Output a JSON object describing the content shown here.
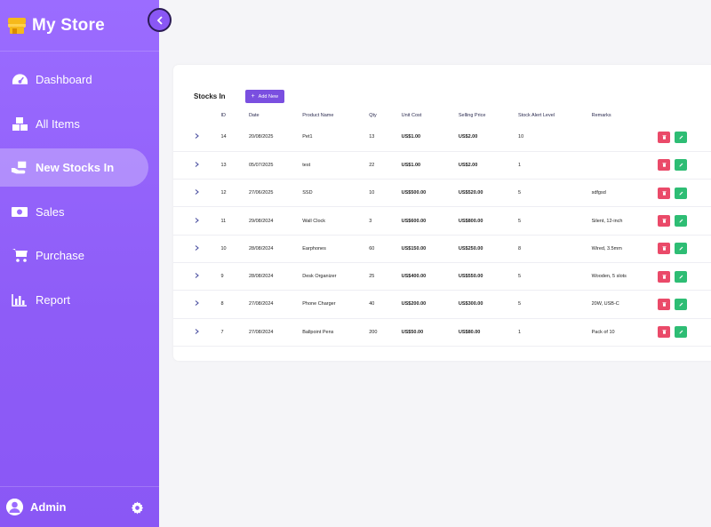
{
  "brand": {
    "title": "My Store"
  },
  "sidebar": {
    "items": [
      {
        "label": "Dashboard",
        "icon": "dashboard-gauge-icon",
        "active": false
      },
      {
        "label": "All Items",
        "icon": "boxes-icon",
        "active": false
      },
      {
        "label": "New Stocks In",
        "icon": "hand-box-icon",
        "active": true
      },
      {
        "label": "Sales",
        "icon": "money-bill-icon",
        "active": false
      },
      {
        "label": "Purchase",
        "icon": "cart-icon",
        "active": false
      },
      {
        "label": "Report",
        "icon": "bar-chart-icon",
        "active": false
      }
    ],
    "footer": {
      "name": "Admin"
    }
  },
  "page": {
    "title": "Stocks In",
    "add_label": "Add New"
  },
  "table": {
    "columns": [
      "ID",
      "Date",
      "Product Name",
      "Qty",
      "Unit Cost",
      "Selling Price",
      "Stock Alert Level",
      "Remarks"
    ],
    "rows": [
      [
        "14",
        "20/08/2025",
        "Pet1",
        "13",
        "US$1.00",
        "US$2.00",
        "10",
        ""
      ],
      [
        "13",
        "05/07/2025",
        "test",
        "22",
        "US$1.00",
        "US$2.00",
        "1",
        ""
      ],
      [
        "12",
        "27/06/2025",
        "SSD",
        "10",
        "US$500.00",
        "US$520.00",
        "5",
        "sdfgsd"
      ],
      [
        "11",
        "29/08/2024",
        "Wall Clock",
        "3",
        "US$600.00",
        "US$800.00",
        "5",
        "Silent, 12-inch"
      ],
      [
        "10",
        "28/08/2024",
        "Earphones",
        "60",
        "US$150.00",
        "US$250.00",
        "8",
        "Wired, 3.5mm"
      ],
      [
        "9",
        "28/08/2024",
        "Desk Organizer",
        "25",
        "US$400.00",
        "US$550.00",
        "5",
        "Wooden, 5 slots"
      ],
      [
        "8",
        "27/08/2024",
        "Phone Charger",
        "40",
        "US$200.00",
        "US$300.00",
        "5",
        "20W, USB-C"
      ],
      [
        "7",
        "27/08/2024",
        "Ballpoint Pens",
        "200",
        "US$50.00",
        "US$80.00",
        "1",
        "Pack of 10"
      ]
    ]
  },
  "colors": {
    "sidebar": "#8e5cf7",
    "accent": "#7a4fe0",
    "delete": "#ea4a69",
    "edit": "#2ebd74",
    "brand_icon": "#f6b91b"
  }
}
